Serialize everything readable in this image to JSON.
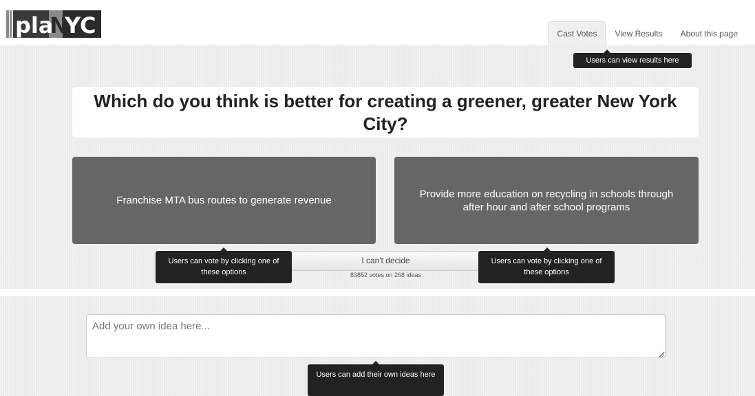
{
  "logo": {
    "text": "planyc",
    "colors": {
      "dark": "#2b2b2b",
      "accent": "#8a8a8a",
      "light": "#ffffff"
    }
  },
  "nav": {
    "tabs": [
      {
        "label": "Cast Votes",
        "active": true
      },
      {
        "label": "View Results",
        "active": false
      },
      {
        "label": "About this page",
        "active": false
      }
    ]
  },
  "question": "Which do you think is better for creating a greener, greater New York City?",
  "options": {
    "left": "Franchise MTA bus routes to generate revenue",
    "right": "Provide more education on recycling in schools through after hour and after school programs"
  },
  "cant_decide_label": "I can't decide",
  "vote_count": "83852 votes on 268 ideas",
  "idea_input": {
    "placeholder": "Add your own idea here...",
    "value": ""
  },
  "tooltips": {
    "view_results": "Users can view results here",
    "vote_left": "Users can vote by clicking one of these options",
    "vote_right": "Users can vote by clicking one of these options",
    "add_idea": "Users can add their own ideas here"
  },
  "colors": {
    "option_bg": "#666666",
    "tooltip_bg": "#222222",
    "section_bg": "#ececec"
  }
}
